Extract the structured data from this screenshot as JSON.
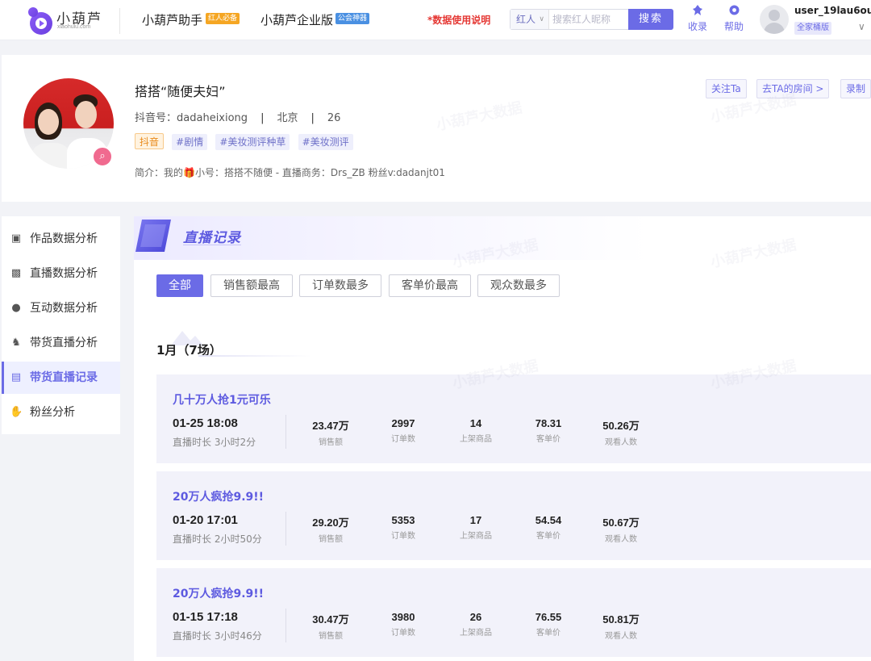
{
  "header": {
    "logo_text": "小葫芦",
    "logo_sub": "xiaohulu.com",
    "nav": [
      {
        "label": "小葫芦助手",
        "tag": "红人必备",
        "tag_color": "#f5a623"
      },
      {
        "label": "小葫芦企业版",
        "tag": "公会神器",
        "tag_color": "#4a90e2"
      }
    ],
    "data_link": "*数据使用说明",
    "search": {
      "select": "红人",
      "placeholder": "搜索红人昵称",
      "button": "搜索"
    },
    "icons": [
      {
        "name": "bookmark-icon",
        "label": "收录"
      },
      {
        "name": "help-icon",
        "label": "帮助"
      }
    ],
    "user": {
      "name": "user_19lau6ou",
      "badge": "全家桶版"
    }
  },
  "profile": {
    "name": "搭搭“随便夫妇”",
    "meta": {
      "id_label": "抖音号：",
      "id": "dadaheixiong",
      "city": "北京",
      "age": "26"
    },
    "platform_tag": "抖音",
    "topic_tags": [
      "#剧情",
      "#美妆测评种草",
      "#美妆测评"
    ],
    "intro": "简介：我的🎁小号：搭搭不随便 - 直播商务：Drs_ZB 粉丝v:dadanjt01",
    "buttons": [
      "关注Ta",
      "去TA的房间 >",
      "录制"
    ]
  },
  "sidebar": {
    "items": [
      {
        "label": "作品数据分析",
        "icon": "video-icon"
      },
      {
        "label": "直播数据分析",
        "icon": "tv-icon"
      },
      {
        "label": "互动数据分析",
        "icon": "chat-icon"
      },
      {
        "label": "带货直播分析",
        "icon": "moneybag-icon"
      },
      {
        "label": "带货直播记录",
        "icon": "record-icon",
        "active": true
      },
      {
        "label": "粉丝分析",
        "icon": "hand-icon"
      }
    ]
  },
  "main": {
    "section_title": "直播记录",
    "filters": [
      "全部",
      "销售额最高",
      "订单数最多",
      "客单价最高",
      "观众数最多"
    ],
    "month": "1月（7场）",
    "stat_labels": [
      "销售额",
      "订单数",
      "上架商品",
      "客单价",
      "观看人数"
    ],
    "records": [
      {
        "title": "几十万人抢1元可乐",
        "date": "01-25 18:08",
        "duration": "直播时长 3小时2分",
        "stats": [
          "23.47万",
          "2997",
          "14",
          "78.31",
          "50.26万"
        ]
      },
      {
        "title": "20万人疯抢9.9!!",
        "date": "01-20 17:01",
        "duration": "直播时长 2小时50分",
        "stats": [
          "29.20万",
          "5353",
          "17",
          "54.54",
          "50.67万"
        ]
      },
      {
        "title": "20万人疯抢9.9!!",
        "date": "01-15 17:18",
        "duration": "直播时长 3小时46分",
        "stats": [
          "30.47万",
          "3980",
          "26",
          "76.55",
          "50.81万"
        ]
      }
    ]
  },
  "watermark": "小葫芦大数据",
  "colors": {
    "accent": "#6b6be6",
    "card_bg": "#f2f2fa",
    "link_red": "#e53935"
  }
}
